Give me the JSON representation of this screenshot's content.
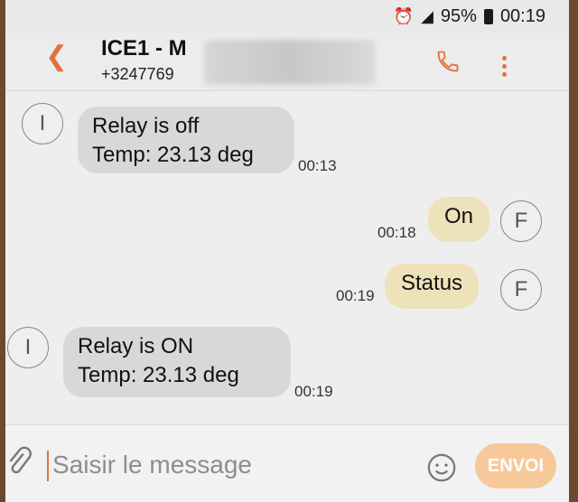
{
  "status_bar": {
    "battery": "95%",
    "time": "00:19",
    "alarm_icon": "alarm-icon",
    "signal_icon": "signal-icon"
  },
  "header": {
    "back_icon": "chevron-left-icon",
    "contact_name": "ICE1 - M",
    "contact_number": "+3247769",
    "call_icon": "phone-icon",
    "menu_icon": "more-vertical-icon"
  },
  "messages": [
    {
      "direction": "in",
      "avatar": "I",
      "lines": [
        "Relay is off",
        "Temp: 23.13 deg"
      ],
      "time": "00:13"
    },
    {
      "direction": "out",
      "avatar": "F",
      "lines": [
        "On"
      ],
      "time": "00:18"
    },
    {
      "direction": "out",
      "avatar": "F",
      "lines": [
        "Status"
      ],
      "time": "00:19"
    },
    {
      "direction": "in",
      "avatar": "I",
      "lines": [
        "Relay is ON",
        "Temp: 23.13 deg"
      ],
      "time": "00:19"
    }
  ],
  "composer": {
    "placeholder": "Saisir le message",
    "send_label": "ENVOI",
    "attach_icon": "paperclip-icon",
    "emoji_icon": "emoji-icon"
  },
  "colors": {
    "accent": "#e0733d",
    "incoming_bubble": "#d8d8d8",
    "outgoing_bubble": "#eee2bb",
    "send_button": "#f7c99a"
  }
}
